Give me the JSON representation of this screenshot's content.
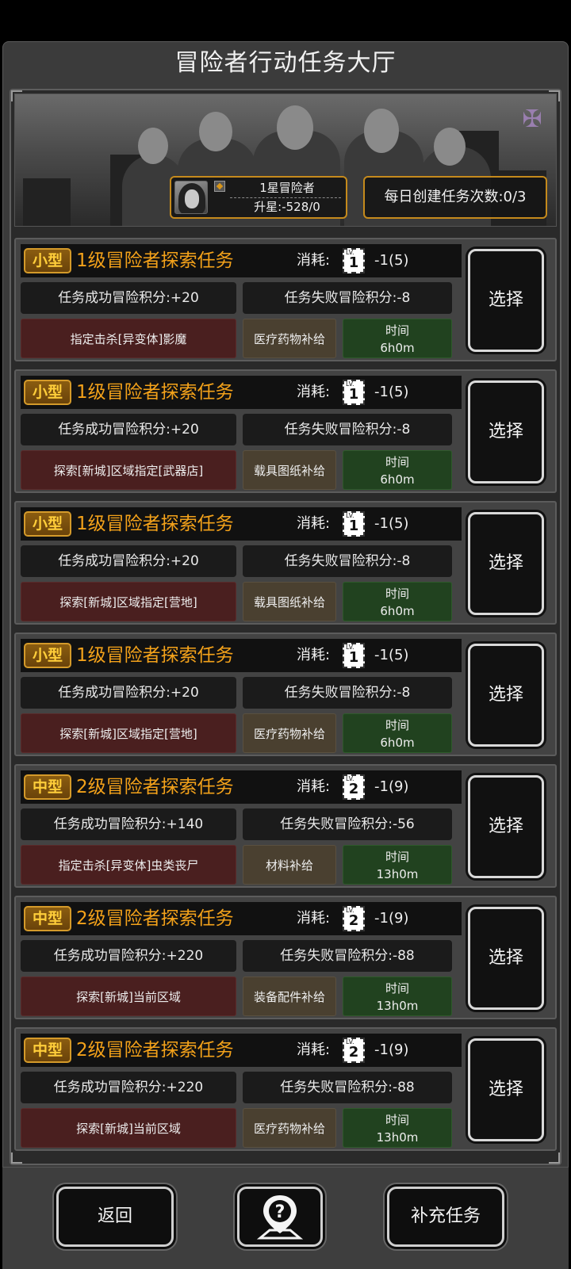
{
  "title": "冒险者行动任务大厅",
  "rank": {
    "name": "1星冒险者",
    "star_progress": "升星:-528/0"
  },
  "daily": "每日创建任务次数:0/3",
  "labels": {
    "cost": "消耗:",
    "time": "时间",
    "select": "选择"
  },
  "missions": [
    {
      "size": "小型",
      "title": "1级冒险者探索任务",
      "ticket": "1",
      "cost": "-1(5)",
      "success": "任务成功冒险积分:+20",
      "fail": "任务失败冒险积分:-8",
      "target": "指定击杀[异变体]影魔",
      "supply": "医疗药物补给",
      "time": "6h0m"
    },
    {
      "size": "小型",
      "title": "1级冒险者探索任务",
      "ticket": "1",
      "cost": "-1(5)",
      "success": "任务成功冒险积分:+20",
      "fail": "任务失败冒险积分:-8",
      "target": "探索[新城]区域指定[武器店]",
      "supply": "载具图纸补给",
      "time": "6h0m"
    },
    {
      "size": "小型",
      "title": "1级冒险者探索任务",
      "ticket": "1",
      "cost": "-1(5)",
      "success": "任务成功冒险积分:+20",
      "fail": "任务失败冒险积分:-8",
      "target": "探索[新城]区域指定[营地]",
      "supply": "载具图纸补给",
      "time": "6h0m"
    },
    {
      "size": "小型",
      "title": "1级冒险者探索任务",
      "ticket": "1",
      "cost": "-1(5)",
      "success": "任务成功冒险积分:+20",
      "fail": "任务失败冒险积分:-8",
      "target": "探索[新城]区域指定[营地]",
      "supply": "医疗药物补给",
      "time": "6h0m"
    },
    {
      "size": "中型",
      "title": "2级冒险者探索任务",
      "ticket": "2",
      "cost": "-1(9)",
      "success": "任务成功冒险积分:+140",
      "fail": "任务失败冒险积分:-56",
      "target": "指定击杀[异变体]虫类丧尸",
      "supply": "材料补给",
      "time": "13h0m"
    },
    {
      "size": "中型",
      "title": "2级冒险者探索任务",
      "ticket": "2",
      "cost": "-1(9)",
      "success": "任务成功冒险积分:+220",
      "fail": "任务失败冒险积分:-88",
      "target": "探索[新城]当前区域",
      "supply": "装备配件补给",
      "time": "13h0m"
    },
    {
      "size": "中型",
      "title": "2级冒险者探索任务",
      "ticket": "2",
      "cost": "-1(9)",
      "success": "任务成功冒险积分:+220",
      "fail": "任务失败冒险积分:-88",
      "target": "探索[新城]当前区域",
      "supply": "医疗药物补给",
      "time": "13h0m"
    }
  ],
  "bottom": {
    "back": "返回",
    "help_icon": "?",
    "refill": "补充任务"
  },
  "colors": {
    "accent": "#f4a21a",
    "badge": "#ffce3a",
    "gold_border": "#c58a1c"
  }
}
